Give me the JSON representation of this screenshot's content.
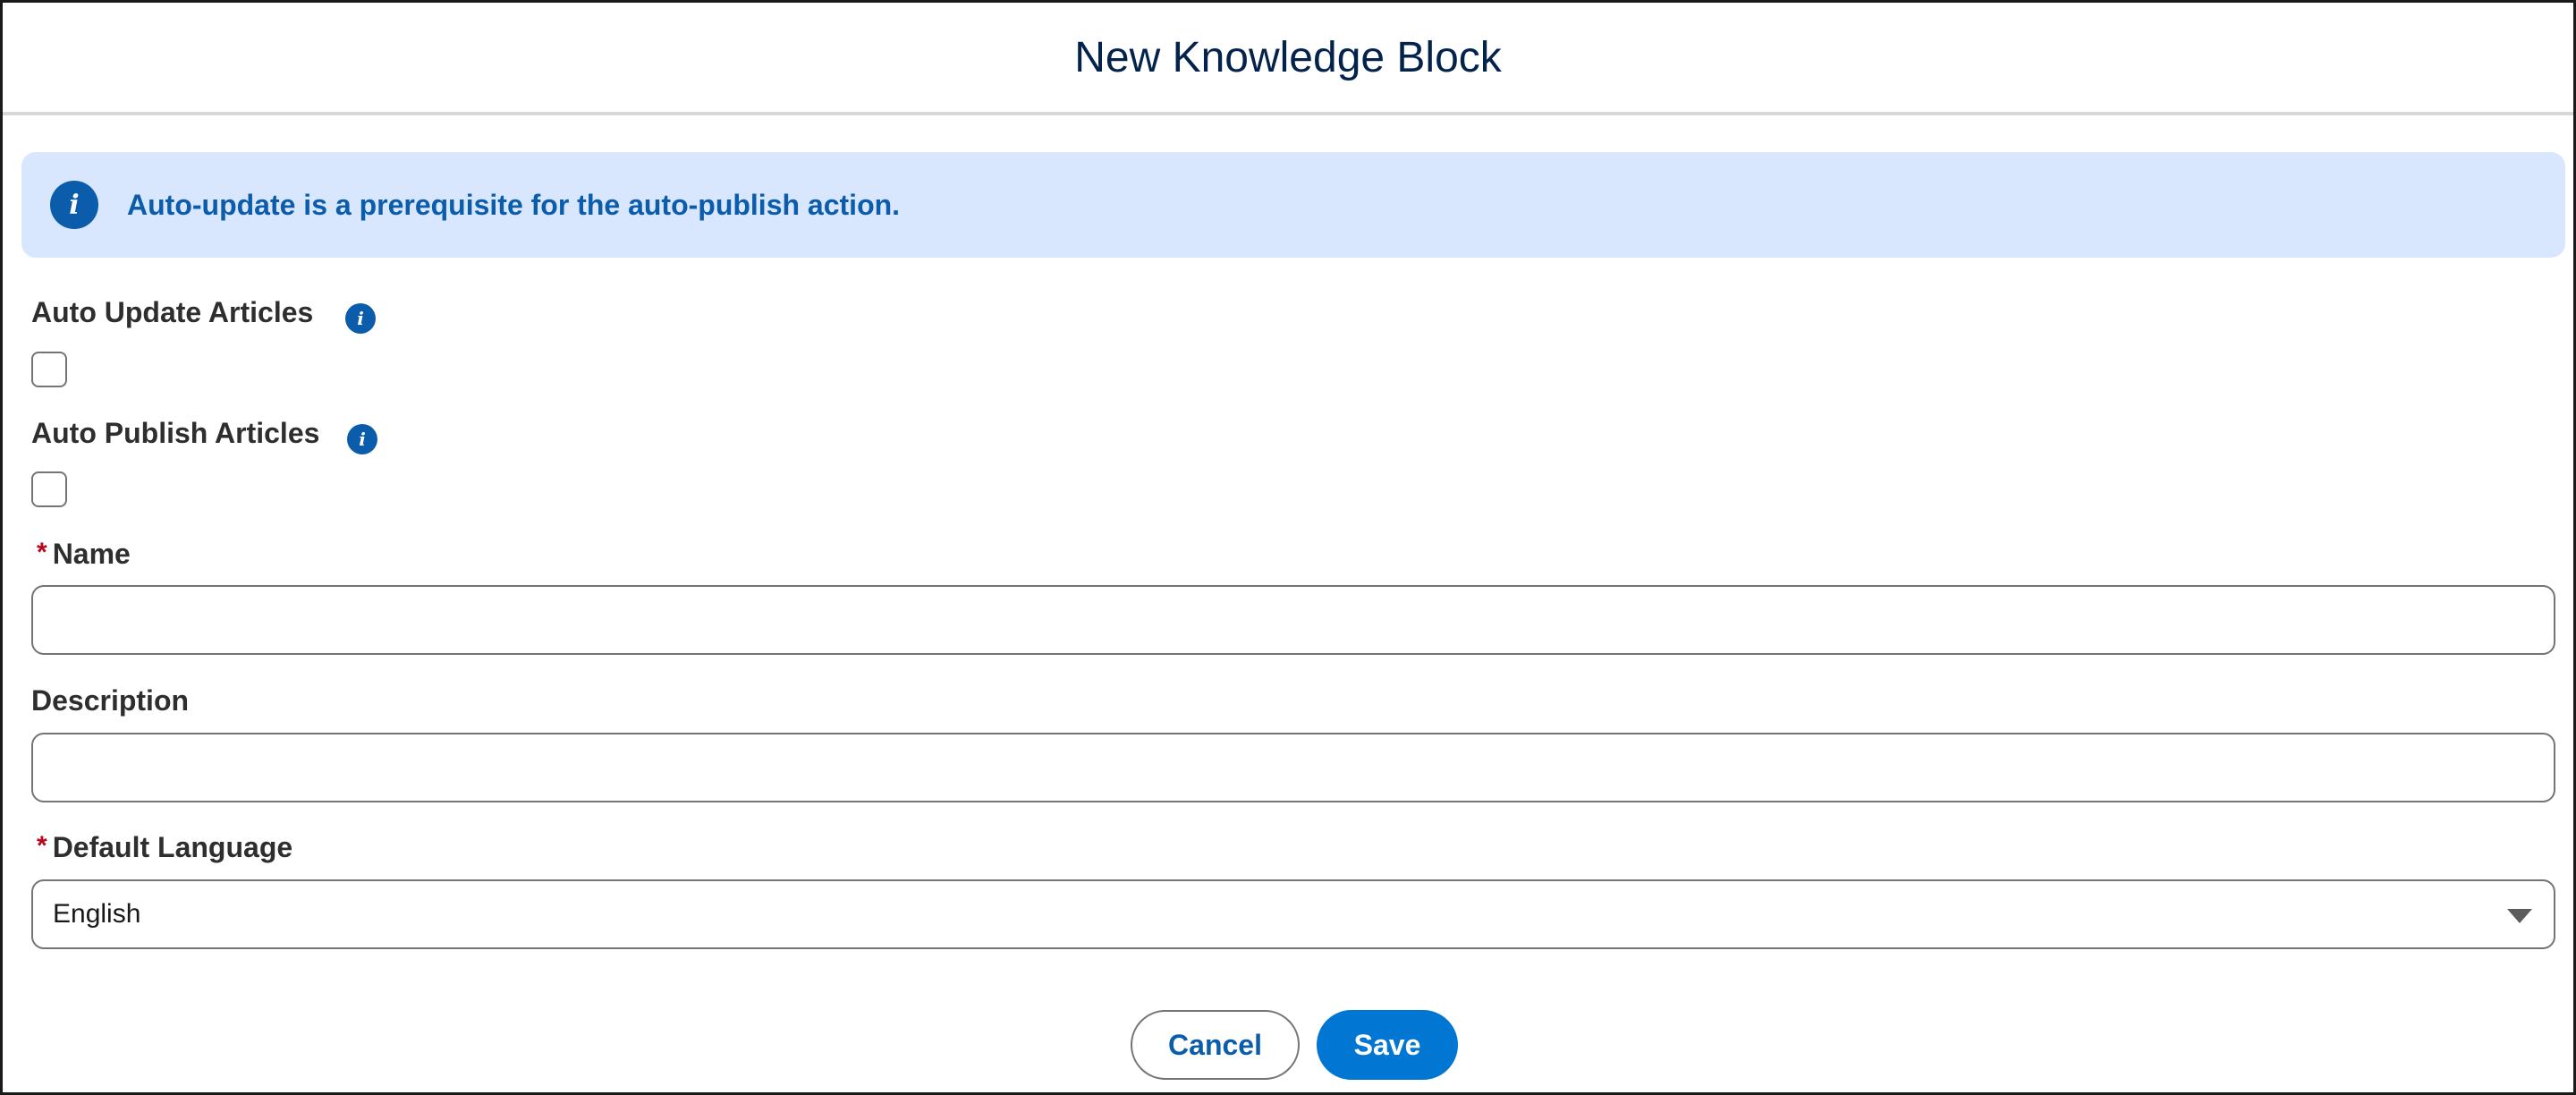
{
  "modal": {
    "title": "New Knowledge Block"
  },
  "alert": {
    "icon": "info-icon",
    "text": "Auto-update is a prerequisite for the auto-publish action."
  },
  "fields": {
    "auto_update": {
      "label": "Auto Update Articles",
      "checked": false,
      "help_icon": "info-icon"
    },
    "auto_publish": {
      "label": "Auto Publish Articles",
      "checked": false,
      "help_icon": "info-icon"
    },
    "name": {
      "required_marker": "*",
      "label": "Name",
      "value": ""
    },
    "description": {
      "label": "Description",
      "value": ""
    },
    "default_language": {
      "required_marker": "*",
      "label": "Default Language",
      "selected": "English"
    }
  },
  "footer": {
    "cancel_label": "Cancel",
    "save_label": "Save"
  },
  "colors": {
    "brand": "#0176d3",
    "info": "#0b5cab",
    "alert_bg": "#d8e6fe",
    "required": "#ba0517",
    "title": "#03234d"
  }
}
